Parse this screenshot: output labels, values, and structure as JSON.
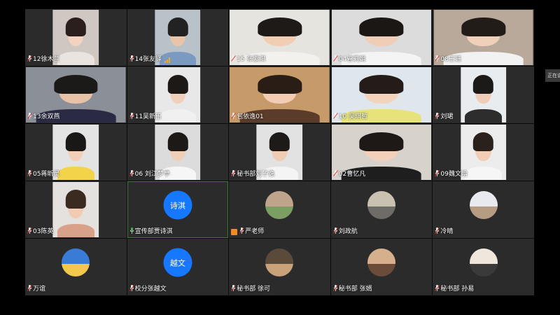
{
  "side_tab": "正在说",
  "colors": {
    "tile_bg": "#2b2b2b",
    "initials_bg": "#1677ff",
    "active_border": "#3c7d3c",
    "signal": "#f5a623"
  },
  "participants": [
    {
      "name": "12徐木兰",
      "mic": "muted",
      "video": "on"
    },
    {
      "name": "14张友铎",
      "mic": "muted",
      "video": "on",
      "signal": true
    },
    {
      "name": "15 张紫淇",
      "mic": "muted",
      "video": "on",
      "wide": true
    },
    {
      "name": "04管莉娟",
      "mic": "muted",
      "video": "on",
      "wide": true
    },
    {
      "name": "08王钰",
      "mic": "muted",
      "video": "on",
      "wide": true
    },
    {
      "name": "13余双燕",
      "mic": "muted",
      "video": "on",
      "wide": true
    },
    {
      "name": "11吴新玉",
      "mic": "muted",
      "video": "on"
    },
    {
      "name": "包依逸01",
      "mic": "muted",
      "video": "on",
      "wide": true
    },
    {
      "name": "10 吴琪哲",
      "mic": "muted",
      "video": "on",
      "wide": true
    },
    {
      "name": "刘珺",
      "mic": "muted",
      "video": "on"
    },
    {
      "name": "05蒋昕灵",
      "mic": "muted",
      "video": "on"
    },
    {
      "name": "06 刘江梦亭",
      "mic": "muted",
      "video": "on"
    },
    {
      "name": "秘书部刘子逸",
      "mic": "muted",
      "video": "on"
    },
    {
      "name": "02曹忆凡",
      "mic": "muted",
      "video": "on",
      "wide": true
    },
    {
      "name": "09魏文暗",
      "mic": "muted",
      "video": "on"
    },
    {
      "name": "03陈英",
      "mic": "muted",
      "video": "on"
    },
    {
      "name": "宣传部贾诗淇",
      "mic": "on",
      "video": "off",
      "initials": "诗淇",
      "active": true
    },
    {
      "name": "严老师",
      "mic": "muted",
      "video": "off",
      "avatar": true,
      "host": true
    },
    {
      "name": "刘政航",
      "mic": "muted",
      "video": "off",
      "avatar": true
    },
    {
      "name": "冷晴",
      "mic": "muted",
      "video": "off",
      "avatar": true
    },
    {
      "name": "万谊",
      "mic": "muted",
      "video": "off",
      "avatar": true
    },
    {
      "name": "校分张越文",
      "mic": "muted",
      "video": "off",
      "initials": "越文"
    },
    {
      "name": "秘书部 徐可",
      "mic": "muted",
      "video": "off",
      "avatar": true
    },
    {
      "name": "秘书部 张婿",
      "mic": "muted",
      "video": "off",
      "avatar": true
    },
    {
      "name": "秘书部 孙易",
      "mic": "muted",
      "video": "off",
      "avatar": true
    }
  ]
}
